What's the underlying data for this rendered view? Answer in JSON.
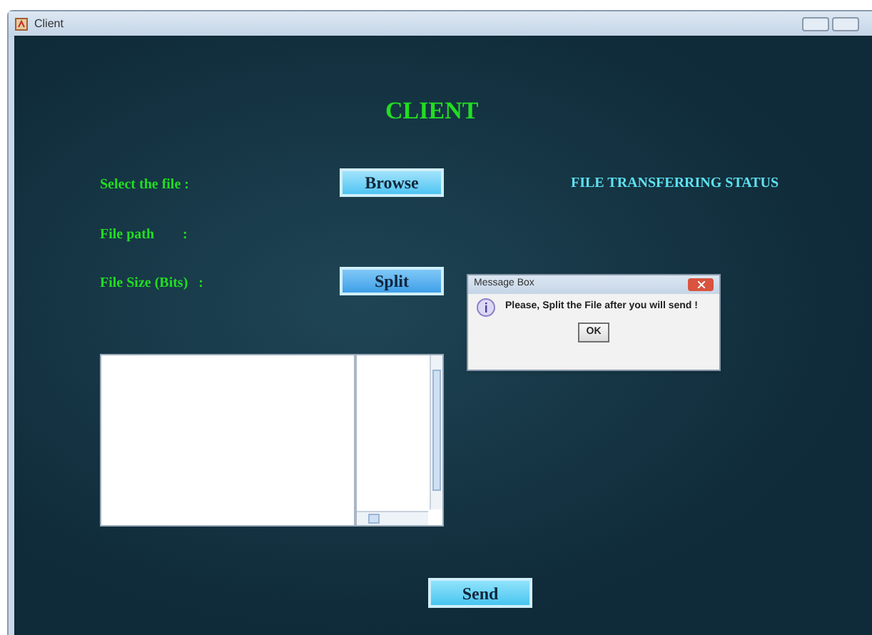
{
  "window": {
    "title": "Client"
  },
  "heading": "CLIENT",
  "labels": [
    "Select the file :",
    "File path        :",
    "File Size (Bits)   :"
  ],
  "buttons": {
    "browse": "Browse",
    "split": "Split",
    "send": "Send"
  },
  "status_title": "FILE TRANSFERRING STATUS",
  "message_box": {
    "title": "Message Box",
    "message": "Please, Split the File after you will send !",
    "ok": "OK"
  }
}
